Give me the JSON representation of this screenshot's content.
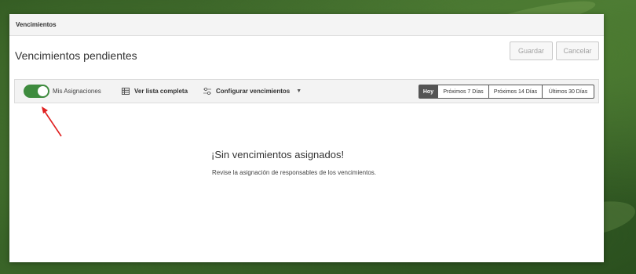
{
  "window": {
    "title": "Vencimientos"
  },
  "header": {
    "page_title": "Vencimientos pendientes",
    "save_label": "Guardar",
    "cancel_label": "Cancelar"
  },
  "toolbar": {
    "toggle_label": "Mis Asignaciones",
    "toggle_on": true,
    "list_label": "Ver lista completa",
    "config_label": "Configurar vencimientos",
    "list_icon": "table-icon",
    "config_icon": "sliders-icon",
    "ranges": [
      {
        "label": "Hoy",
        "active": true
      },
      {
        "label": "Próximos 7 Días",
        "active": false
      },
      {
        "label": "Próximos 14 Días",
        "active": false
      },
      {
        "label": "Últimos 30 Días",
        "active": false
      }
    ]
  },
  "empty_state": {
    "title": "¡Sin vencimientos asignados!",
    "description": "Revise la asignación de responsables de los vencimientos."
  },
  "colors": {
    "toggle_on": "#3e8b3e",
    "annotation_arrow": "#e02020",
    "active_segment": "#555555"
  }
}
